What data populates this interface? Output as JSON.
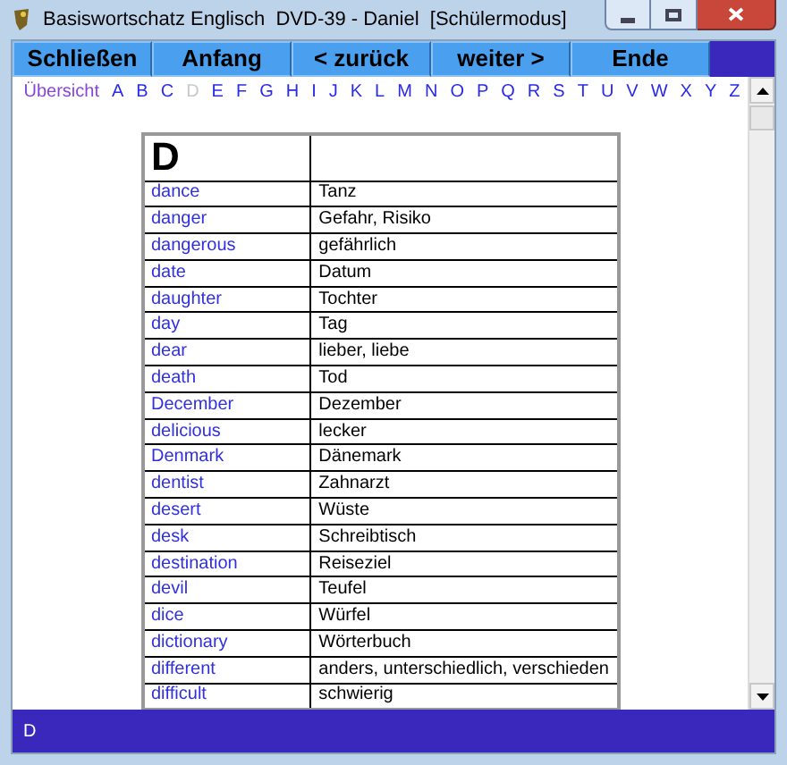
{
  "window": {
    "title": "Basiswortschatz Englisch  DVD-39 - Daniel  [Schülermodus]"
  },
  "toolbar": {
    "buttons": [
      "Schließen",
      "Anfang",
      "< zurück",
      "weiter >",
      "Ende"
    ]
  },
  "alphabet": [
    {
      "label": "Übersicht",
      "selected": false
    },
    {
      "label": "A",
      "selected": false
    },
    {
      "label": "B",
      "selected": false
    },
    {
      "label": "C",
      "selected": false
    },
    {
      "label": "D",
      "selected": true
    },
    {
      "label": "E",
      "selected": false
    },
    {
      "label": "F",
      "selected": false
    },
    {
      "label": "G",
      "selected": false
    },
    {
      "label": "H",
      "selected": false
    },
    {
      "label": "I",
      "selected": false
    },
    {
      "label": "J",
      "selected": false
    },
    {
      "label": "K",
      "selected": false
    },
    {
      "label": "L",
      "selected": false
    },
    {
      "label": "M",
      "selected": false
    },
    {
      "label": "N",
      "selected": false
    },
    {
      "label": "O",
      "selected": false
    },
    {
      "label": "P",
      "selected": false
    },
    {
      "label": "Q",
      "selected": false
    },
    {
      "label": "R",
      "selected": false
    },
    {
      "label": "S",
      "selected": false
    },
    {
      "label": "T",
      "selected": false
    },
    {
      "label": "U",
      "selected": false
    },
    {
      "label": "V",
      "selected": false
    },
    {
      "label": "W",
      "selected": false
    },
    {
      "label": "X",
      "selected": false
    },
    {
      "label": "Y",
      "selected": false
    },
    {
      "label": "Z",
      "selected": false
    }
  ],
  "table": {
    "heading": "D",
    "rows": [
      {
        "word": "dance",
        "translation": "Tanz"
      },
      {
        "word": "danger",
        "translation": "Gefahr, Risiko"
      },
      {
        "word": "dangerous",
        "translation": "gefährlich"
      },
      {
        "word": "date",
        "translation": "Datum"
      },
      {
        "word": "daughter",
        "translation": "Tochter"
      },
      {
        "word": "day",
        "translation": "Tag"
      },
      {
        "word": "dear",
        "translation": "lieber, liebe"
      },
      {
        "word": "death",
        "translation": "Tod"
      },
      {
        "word": "December",
        "translation": "Dezember"
      },
      {
        "word": "delicious",
        "translation": "lecker"
      },
      {
        "word": "Denmark",
        "translation": "Dänemark"
      },
      {
        "word": "dentist",
        "translation": "Zahnarzt"
      },
      {
        "word": "desert",
        "translation": "Wüste"
      },
      {
        "word": "desk",
        "translation": "Schreibtisch"
      },
      {
        "word": "destination",
        "translation": "Reiseziel"
      },
      {
        "word": "devil",
        "translation": "Teufel"
      },
      {
        "word": "dice",
        "translation": "Würfel"
      },
      {
        "word": "dictionary",
        "translation": "Wörterbuch"
      },
      {
        "word": "different",
        "translation": "anders, unterschiedlich, verschieden"
      },
      {
        "word": "difficult",
        "translation": "schwierig"
      }
    ]
  },
  "status_bar": {
    "text": "D"
  }
}
